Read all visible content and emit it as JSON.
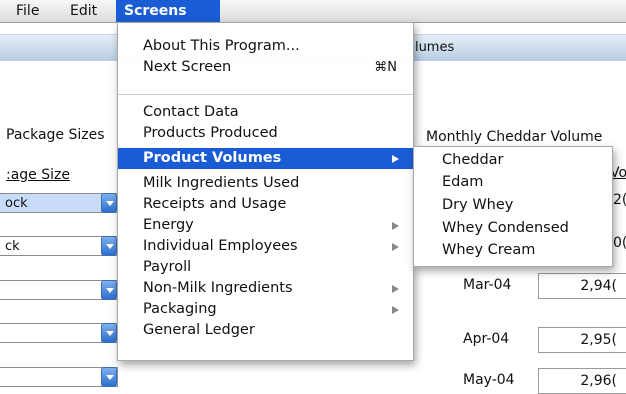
{
  "menubar": {
    "file": "File",
    "edit": "Edit",
    "screens": "Screens"
  },
  "window": {
    "title": "olumes"
  },
  "left_panel": {
    "header": "Package Sizes",
    "column_header": ":age Size",
    "rows": [
      "ock",
      "ck",
      "",
      "",
      ""
    ]
  },
  "right_panel": {
    "header": "Monthly Cheddar Volume",
    "column_header": "Vo",
    "values": [
      "2(",
      "0("
    ],
    "rows": [
      {
        "month": "Mar-04",
        "value": "2,94("
      },
      {
        "month": "Apr-04",
        "value": "2,95("
      },
      {
        "month": "May-04",
        "value": "2,96("
      }
    ]
  },
  "screens_menu": {
    "items": [
      {
        "label": "About This Program..."
      },
      {
        "label": "Next Screen",
        "shortcut": "⌘N"
      },
      {
        "label": "Contact Data"
      },
      {
        "label": "Products Produced"
      },
      {
        "label": "Product Volumes",
        "submenu": true,
        "highlighted": true
      },
      {
        "label": "Milk Ingredients Used"
      },
      {
        "label": "Receipts and Usage"
      },
      {
        "label": "Energy",
        "submenu": true
      },
      {
        "label": "Individual Employees",
        "submenu": true
      },
      {
        "label": "Payroll"
      },
      {
        "label": "Non-Milk Ingredients",
        "submenu": true
      },
      {
        "label": "Packaging",
        "submenu": true
      },
      {
        "label": "General Ledger"
      }
    ]
  },
  "product_volumes_submenu": {
    "items": [
      "Cheddar",
      "Edam",
      "Dry Whey",
      "Whey Condensed",
      "Whey Cream"
    ]
  },
  "colors": {
    "highlight": "#1a5cd3"
  }
}
